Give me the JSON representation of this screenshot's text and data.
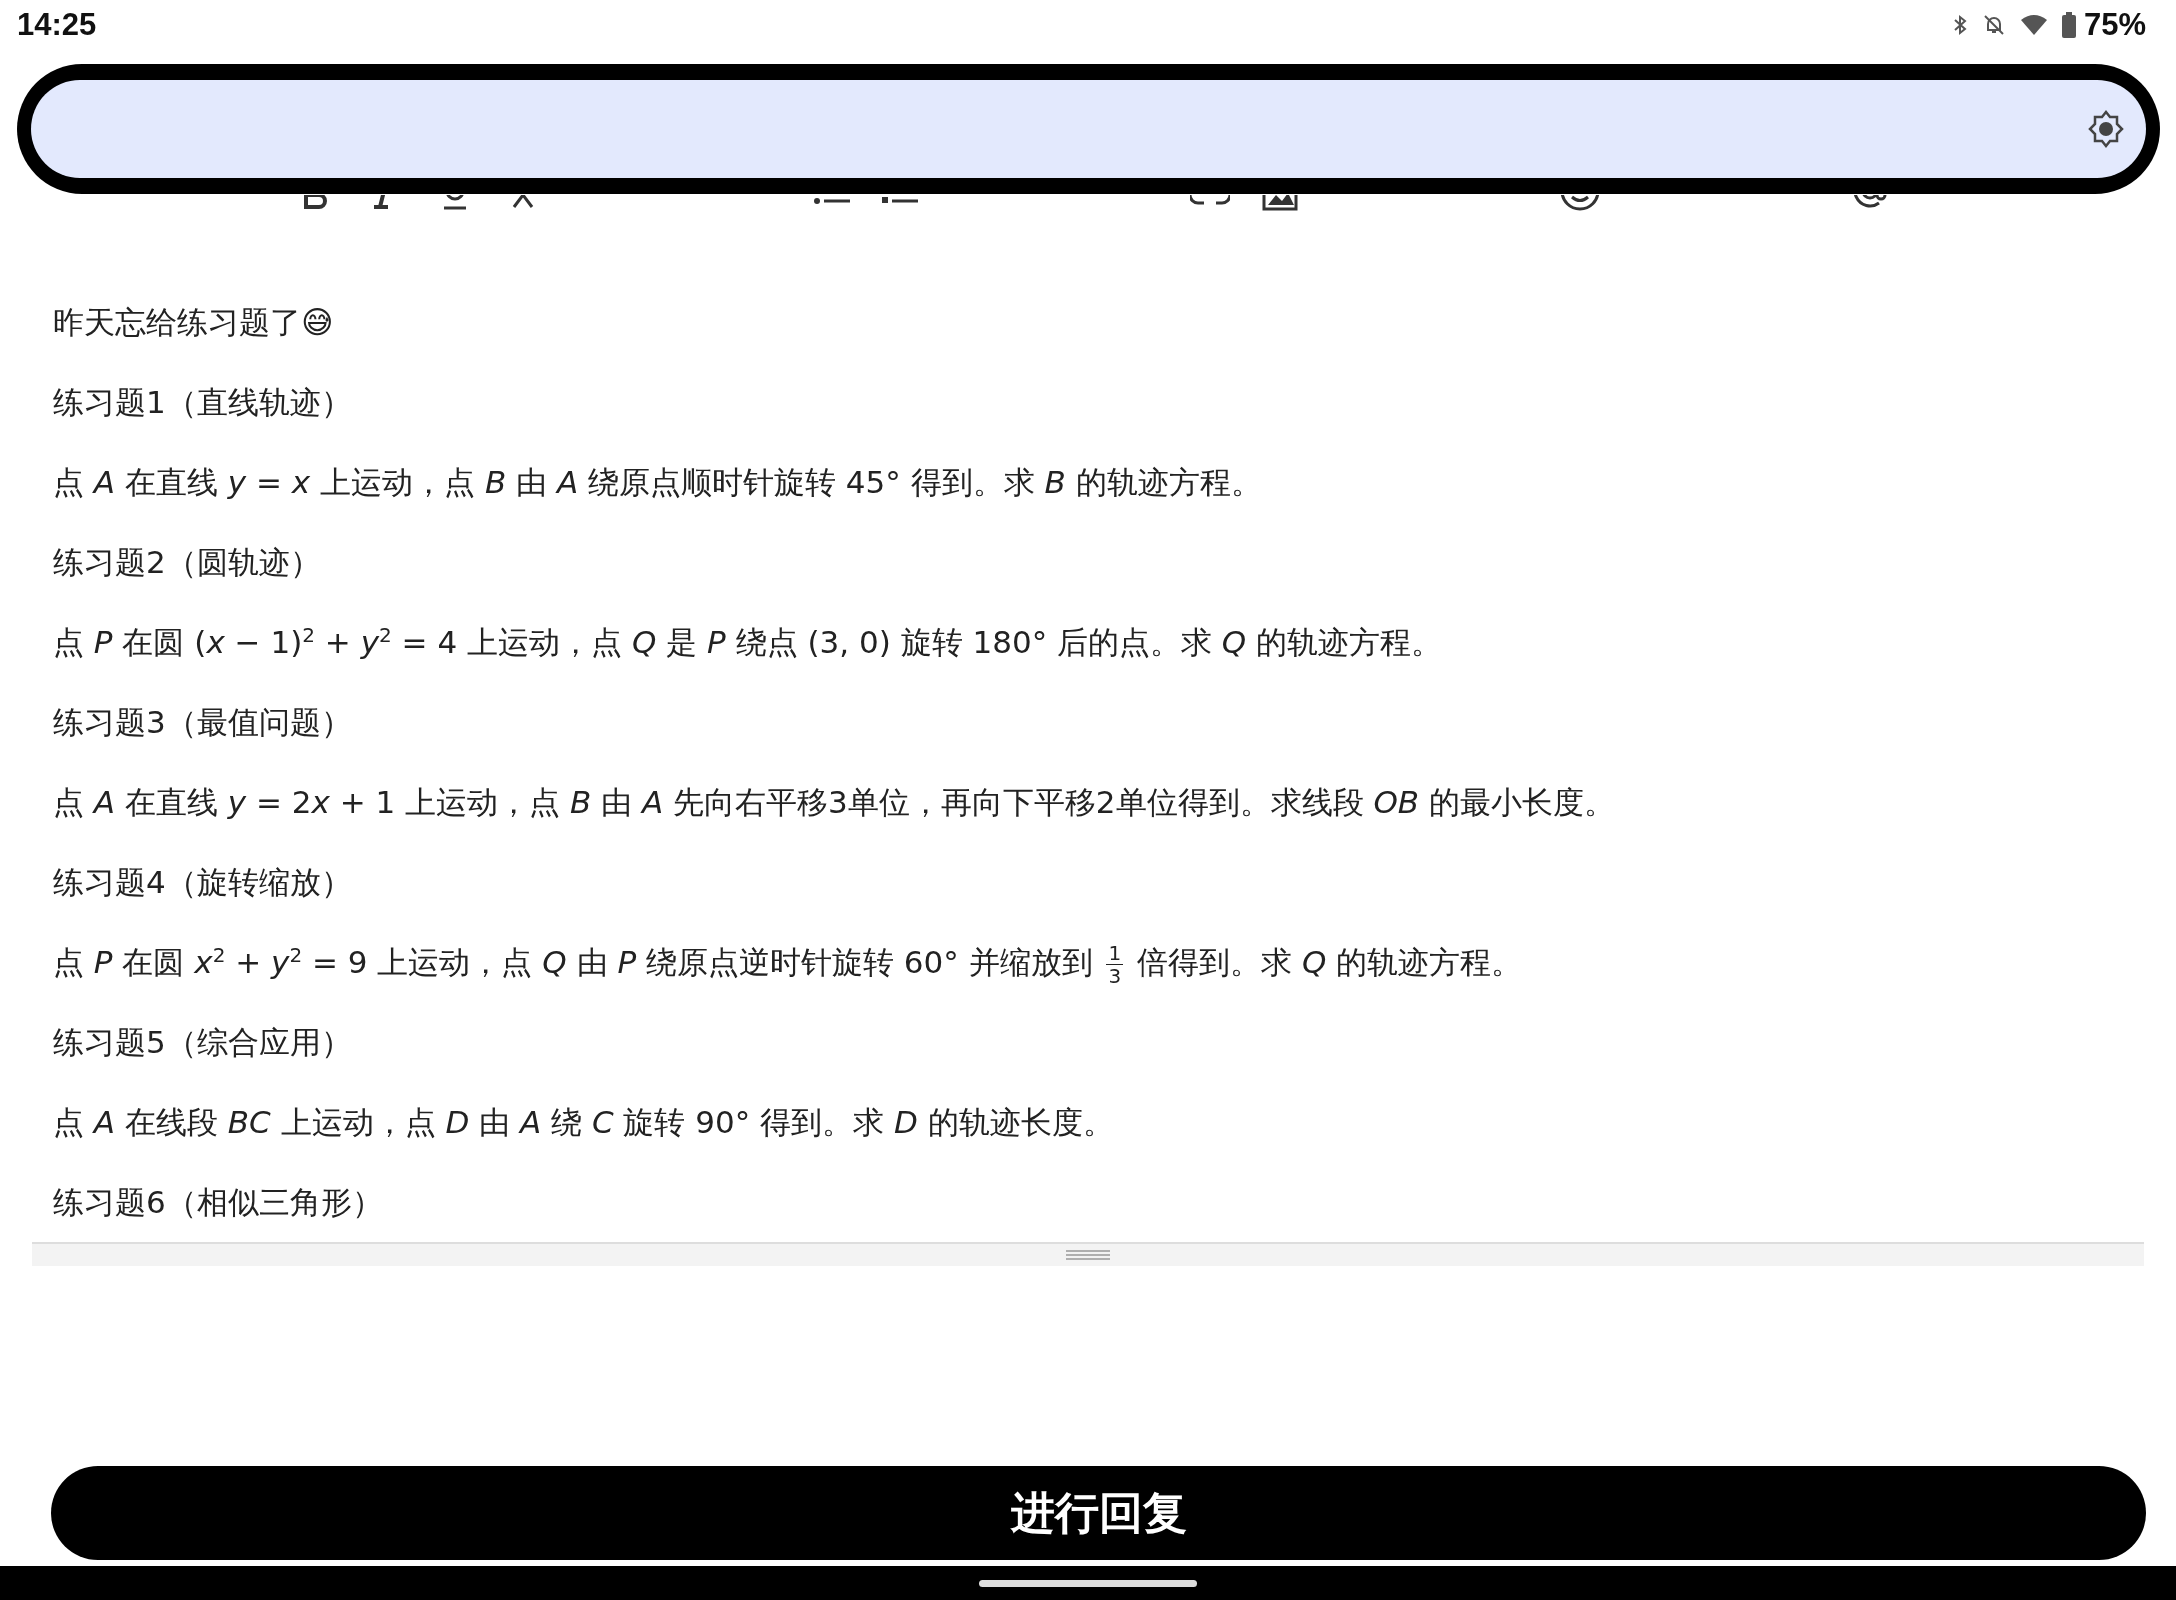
{
  "status_bar": {
    "time": "14:25",
    "battery": "75%"
  },
  "paragraphs": [
    {
      "parts": [
        {
          "kind": "text",
          "text": "昨天忘给练习题了😅"
        }
      ]
    },
    {
      "parts": [
        {
          "kind": "text",
          "text": "练习题1（直线轨迹）"
        }
      ]
    },
    {
      "parts": [
        {
          "kind": "text",
          "text": "点 *A* 在直线 *y* = *x* 上运动，点 *B* 由 *A* 绕原点顺时针旋转 45° 得到。求 *B* 的轨迹方程。"
        }
      ]
    },
    {
      "parts": [
        {
          "kind": "text",
          "text": "练习题2（圆轨迹）"
        }
      ]
    },
    {
      "parts": [
        {
          "kind": "text",
          "text": "点 *P* 在圆 (*x* − 1)$^{2}$ + *y*$^{2}$ = 4 上运动，点 *Q* 是 *P* 绕点 (3, 0) 旋转 180° 后的点。求 *Q* 的轨迹方程。"
        }
      ]
    },
    {
      "parts": [
        {
          "kind": "text",
          "text": "练习题3（最值问题）"
        }
      ]
    },
    {
      "parts": [
        {
          "kind": "text",
          "text": "点 *A* 在直线 *y* = 2"
        },
        {
          "kind": "text",
          "text": "*x* + 1 上运动，点 *B* 由 *A* 先向右平移3单位，再向下平移2单位得到。求线段 *OB* 的最小长度。"
        }
      ]
    },
    {
      "parts": [
        {
          "kind": "text",
          "text": "练习题4（旋转缩放）"
        }
      ]
    },
    {
      "parts": [
        {
          "kind": "text",
          "text": "点 *P* 在圆 *x*$^{2}$ + *y*$^{2}$ = 9 上运动，点 *Q* 由 *P* 绕原点逆时针旋转 60° 并缩放到 "
        },
        {
          "kind": "fraction",
          "numerator": "1",
          "denominator": "3"
        },
        {
          "kind": "text",
          "text": " 倍得到。求 *Q* 的轨迹方程。"
        }
      ]
    },
    {
      "parts": [
        {
          "kind": "text",
          "text": "练习题5（综合应用）"
        }
      ]
    },
    {
      "parts": [
        {
          "kind": "text",
          "text": "点 *A* 在线段 *BC* 上运动，点 *D* 由 *A* 绕 *C* 旋转 90° 得到。求 *D* 的轨迹长度。"
        }
      ]
    },
    {
      "parts": [
        {
          "kind": "text",
          "text": "练习题6（相似三角形）"
        }
      ]
    }
  ],
  "reply_button": {
    "label": "进行回复"
  }
}
